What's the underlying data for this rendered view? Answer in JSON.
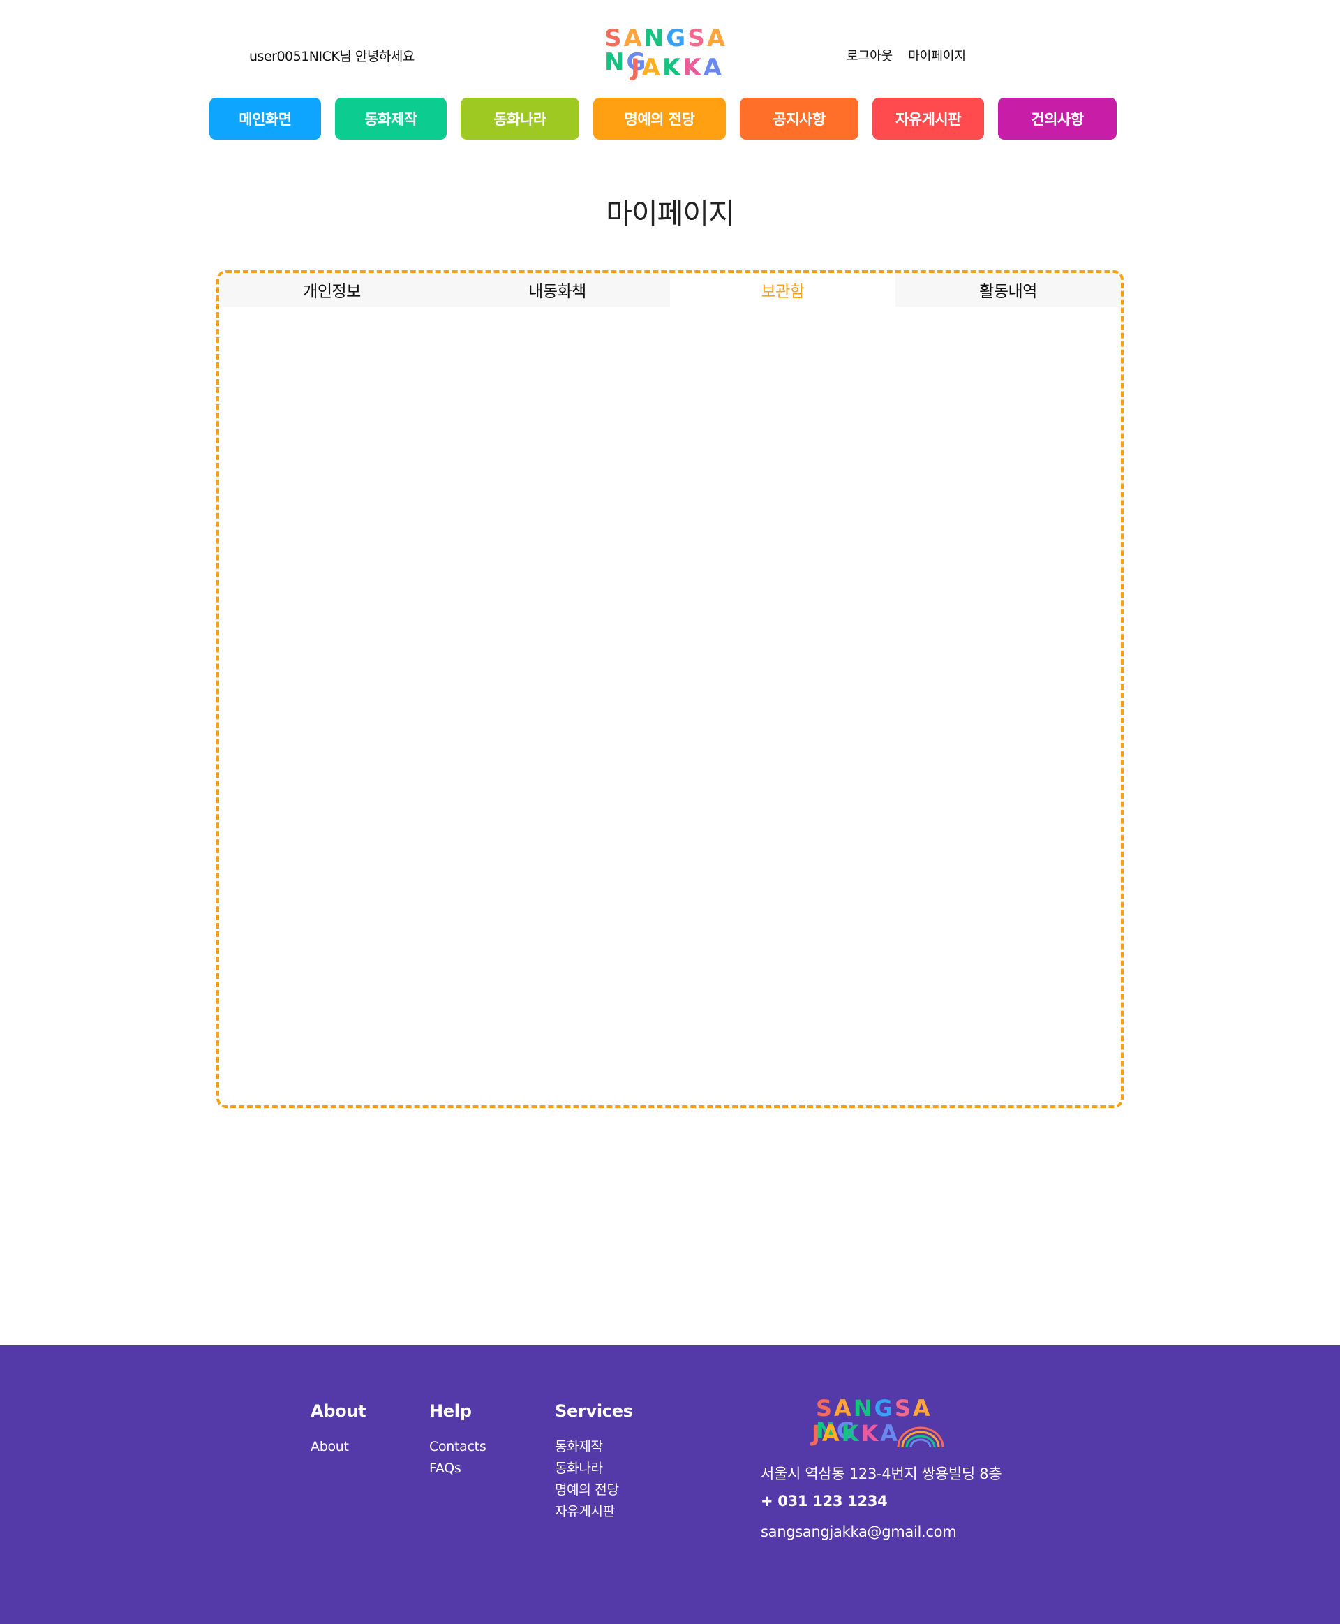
{
  "header": {
    "greeting": "user0051NICK님 안녕하세요",
    "logo_line1": [
      "S",
      "A",
      "N",
      "G",
      "S",
      "A",
      "N",
      "G"
    ],
    "logo_line2": [
      "J",
      "A",
      "K",
      "K",
      "A"
    ],
    "logout": "로그아웃",
    "mypage": "마이페이지"
  },
  "nav": [
    {
      "label": "메인화면",
      "color": "#0ea5ff"
    },
    {
      "label": "동화제작",
      "color": "#0ccc8f"
    },
    {
      "label": "동화나라",
      "color": "#9ec923"
    },
    {
      "label": "명예의 전당",
      "color": "#ff9f12"
    },
    {
      "label": "공지사항",
      "color": "#ff6f29"
    },
    {
      "label": "자유게시판",
      "color": "#ff4a4e"
    },
    {
      "label": "건의사항",
      "color": "#c81ea7"
    }
  ],
  "page_title": "마이페이지",
  "tabs": [
    "개인정보",
    "내동화책",
    "보관함",
    "활동내역"
  ],
  "active_tab": "보관함",
  "footer": {
    "about": {
      "title": "About",
      "links": [
        "About"
      ]
    },
    "help": {
      "title": "Help",
      "links": [
        "Contacts",
        "FAQs"
      ]
    },
    "services": {
      "title": "Services",
      "links": [
        "동화제작",
        "동화나라",
        "명예의 전당",
        "자유게시판"
      ]
    },
    "address": "서울시 역삼동 123-4번지 쌍용빌딩 8층",
    "phone": "+ 031 123 1234",
    "email": "sangsangjakka@gmail.com"
  },
  "colors": {
    "accent": "#ff9f12",
    "footer_bg": "#543aa8",
    "logo_letters": [
      "#f26b5b",
      "#ffa53b",
      "#14c37f",
      "#3aa0f5",
      "#ef6a8e",
      "#ffa53b",
      "#14c37f",
      "#6a88ee"
    ],
    "logo_letters2": [
      "#f26b5b",
      "#ffb020",
      "#14c37f",
      "#ef5b9a",
      "#6a88ee"
    ]
  }
}
